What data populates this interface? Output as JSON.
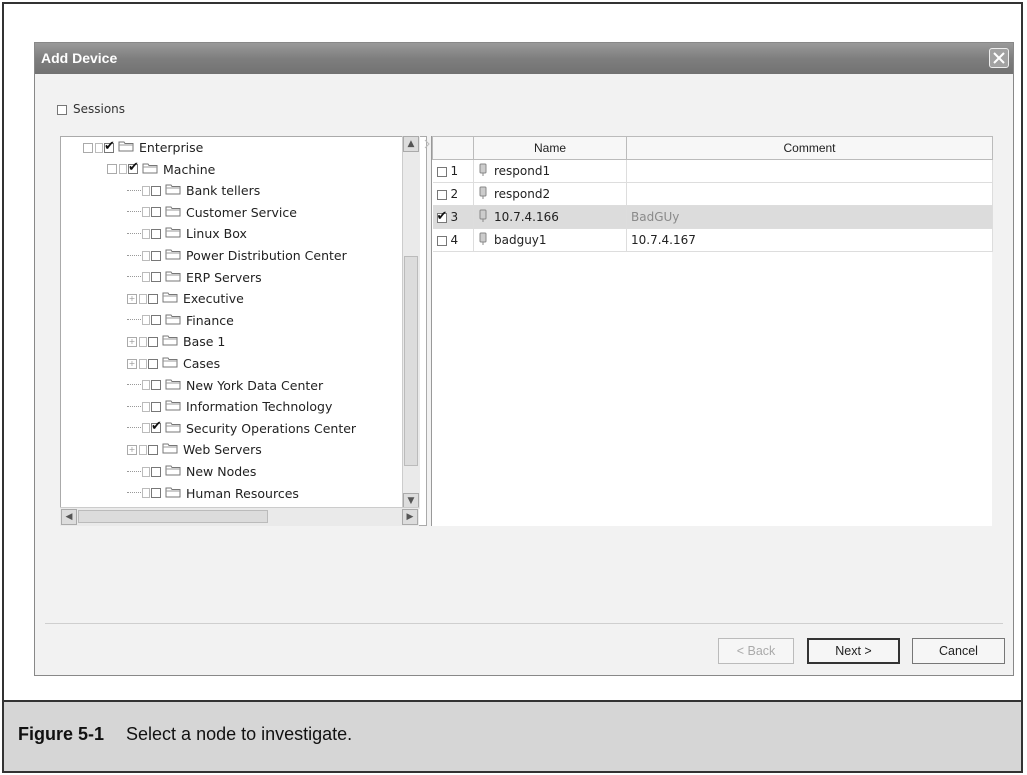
{
  "dialog": {
    "title": "Add Device"
  },
  "sessions": {
    "label": "Sessions",
    "checked": false
  },
  "tree": {
    "items": [
      {
        "label": "Enterprise",
        "level": 0,
        "checked": true
      },
      {
        "label": "Machine",
        "level": 1,
        "checked": true
      },
      {
        "label": "Bank tellers",
        "level": 2,
        "checked": false
      },
      {
        "label": "Customer Service",
        "level": 2,
        "checked": false
      },
      {
        "label": "Linux Box",
        "level": 2,
        "checked": false
      },
      {
        "label": "Power Distribution Center",
        "level": 2,
        "checked": false
      },
      {
        "label": "ERP Servers",
        "level": 2,
        "checked": false
      },
      {
        "label": "Executive",
        "level": 2,
        "checked": false,
        "expandable": true
      },
      {
        "label": "Finance",
        "level": 2,
        "checked": false
      },
      {
        "label": "Base 1",
        "level": 2,
        "checked": false,
        "expandable": true
      },
      {
        "label": "Cases",
        "level": 2,
        "checked": false,
        "expandable": true
      },
      {
        "label": "New York Data Center",
        "level": 2,
        "checked": false
      },
      {
        "label": "Information Technology",
        "level": 2,
        "checked": false
      },
      {
        "label": "Security Operations Center",
        "level": 2,
        "checked": true
      },
      {
        "label": "Web Servers",
        "level": 2,
        "checked": false,
        "expandable": true
      },
      {
        "label": "New Nodes",
        "level": 2,
        "checked": false
      },
      {
        "label": "Human Resources",
        "level": 2,
        "checked": false
      }
    ]
  },
  "grid": {
    "columns": [
      "Name",
      "Comment"
    ],
    "rows": [
      {
        "num": "1",
        "name": "respond1",
        "comment": "",
        "checked": false
      },
      {
        "num": "2",
        "name": "respond2",
        "comment": "",
        "checked": false
      },
      {
        "num": "3",
        "name": "10.7.4.166",
        "comment": "BadGUy",
        "checked": true,
        "selected": true
      },
      {
        "num": "4",
        "name": "badguy1",
        "comment": "10.7.4.167",
        "checked": false
      }
    ]
  },
  "buttons": {
    "back": "< Back",
    "next": "Next >",
    "cancel": "Cancel"
  },
  "caption": {
    "figure": "Figure 5-1",
    "text": "Select a node to investigate."
  }
}
